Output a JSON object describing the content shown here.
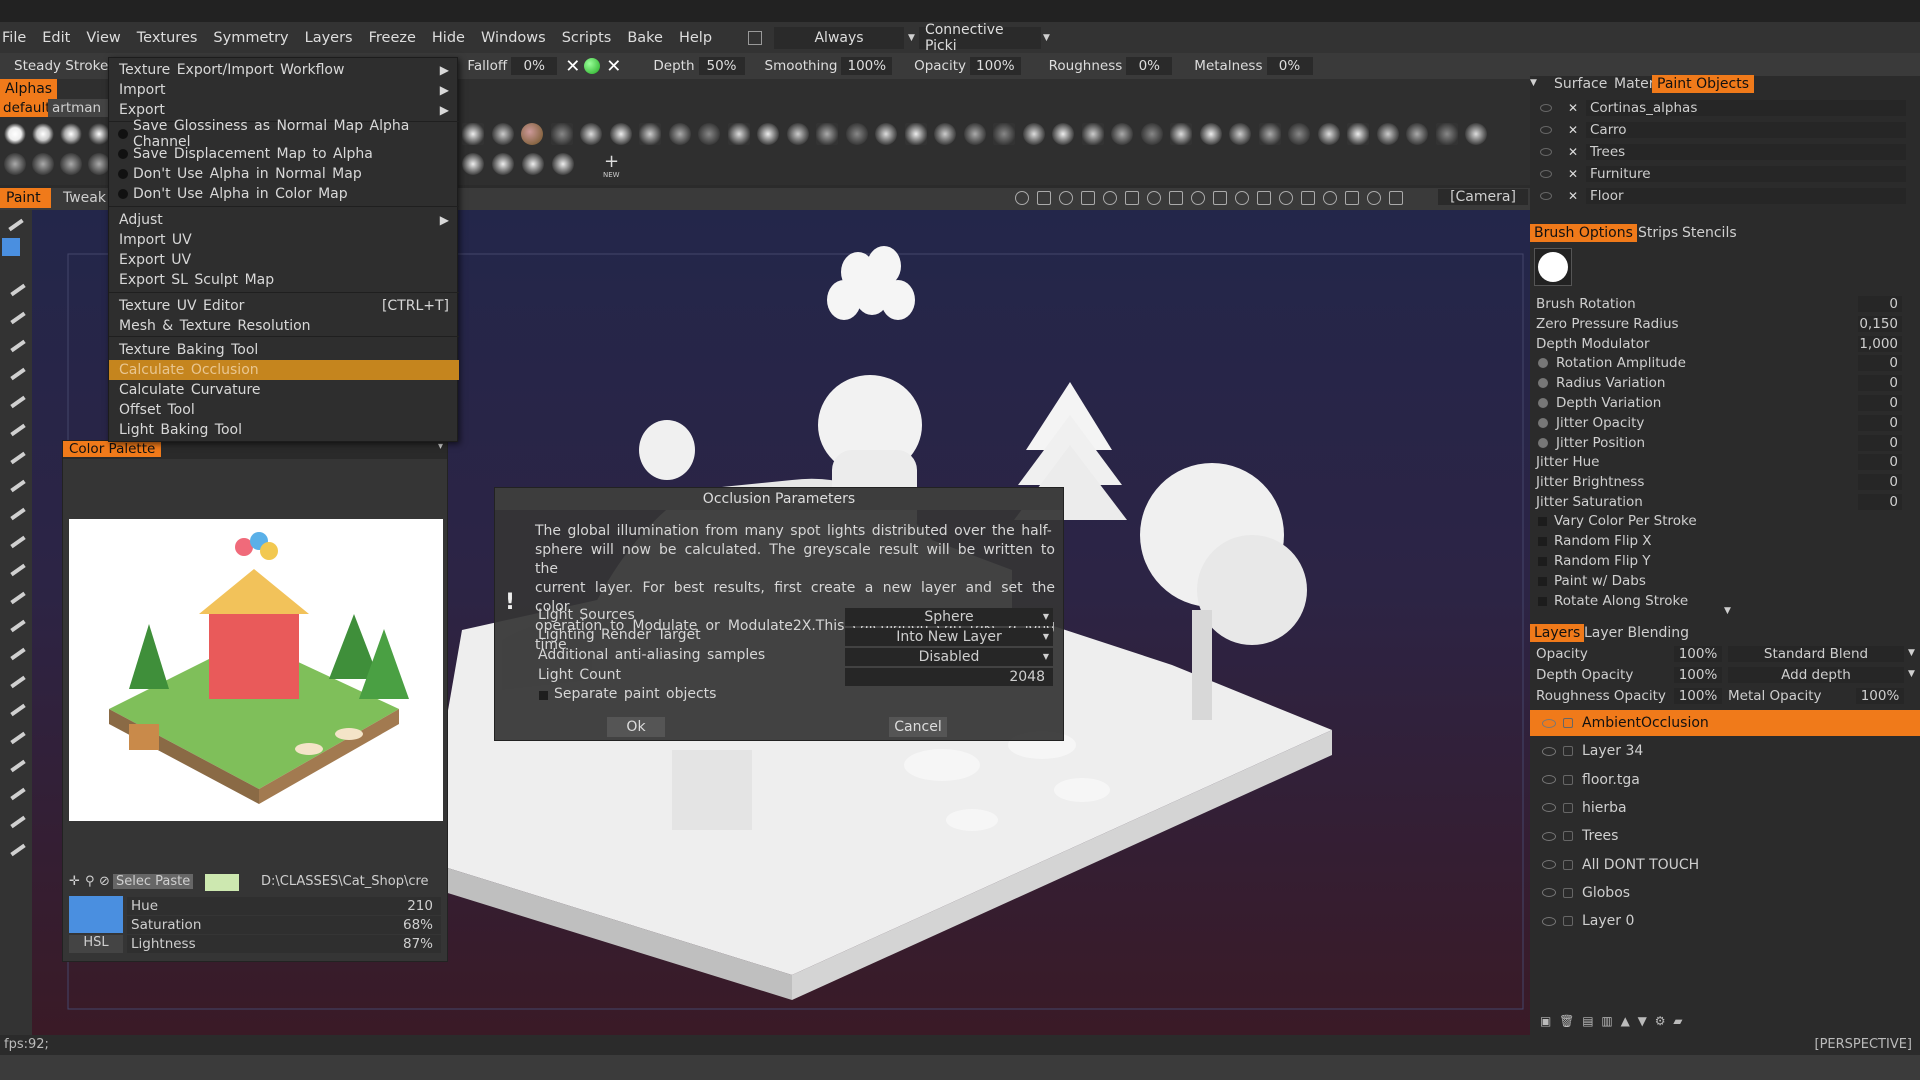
{
  "menubar": {
    "items": [
      "File",
      "Edit",
      "View",
      "Textures",
      "Symmetry",
      "Layers",
      "Freeze",
      "Hide",
      "Windows",
      "Scripts",
      "Bake",
      "Help"
    ],
    "always": "Always",
    "connective": "Connective Picki"
  },
  "toolbar": {
    "steady": "Steady",
    "stroke": "Stroke",
    "falloff": "Falloff",
    "falloff_val": "0%",
    "depth": "Depth",
    "depth_val": "50%",
    "smoothing": "Smoothing",
    "smoothing_val": "100%",
    "opacity": "Opacity",
    "opacity_val": "100%",
    "roughness": "Roughness",
    "roughness_val": "0%",
    "metalness": "Metalness",
    "metalness_val": "0%"
  },
  "alphas": {
    "tab": "Alphas",
    "preset_default": "default",
    "preset_artman": "artman",
    "new_label": "NEW"
  },
  "paint_tabs": {
    "paint": "Paint",
    "tweak": "Tweak",
    "camera": "[Camera]"
  },
  "textures_menu": {
    "items": [
      {
        "label": "Texture Export/Import Workflow",
        "submenu": true
      },
      {
        "label": "Import",
        "submenu": true
      },
      {
        "label": "Export",
        "submenu": true
      },
      {
        "label": "Save Glossiness as Normal Map Alpha Channel",
        "bullet": true
      },
      {
        "label": "Save Displacement Map to Alpha",
        "bullet": true
      },
      {
        "label": "Don't Use Alpha in Normal Map",
        "bullet": true
      },
      {
        "label": "Don't Use Alpha in Color Map",
        "bullet": true
      },
      {
        "label": "Adjust",
        "submenu": true
      },
      {
        "label": "Import UV"
      },
      {
        "label": "Export UV"
      },
      {
        "label": "Export SL Sculpt Map"
      },
      {
        "label": "Texture UV Editor",
        "shortcut": "[CTRL+T]"
      },
      {
        "label": "Mesh & Texture Resolution"
      },
      {
        "label": "Texture Baking Tool"
      },
      {
        "label": "Calculate Occlusion",
        "highlighted": true
      },
      {
        "label": "Calculate Curvature"
      },
      {
        "label": "Offset Tool"
      },
      {
        "label": "Light Baking Tool"
      }
    ]
  },
  "color_palette": {
    "title": "Color Palette",
    "selec_paste": "Selec Paste",
    "path": "D:\\CLASSES\\Cat_Shop\\cre",
    "hue_label": "Hue",
    "hue": "210",
    "sat_label": "Saturation",
    "sat": "68%",
    "light_label": "Lightness",
    "light": "87%",
    "mode": "HSL",
    "swatch_color": "#4a8fe0"
  },
  "dialog": {
    "title": "Occlusion Parameters",
    "text": [
      "The global illumination from many spot lights distributed over the half-",
      "sphere will now be calculated. The greyscale result will be written to the",
      "current layer. For best results, first create a new layer and set the color",
      "operation to Modulate or Modulate2X.This calculation can take a long time"
    ],
    "light_sources_label": "Light Sources",
    "light_sources": "Sphere",
    "render_target_label": "Lighting Render Target",
    "render_target": "Into New Layer",
    "aa_label": "Additional anti-aliasing samples",
    "aa": "Disabled",
    "light_count_label": "Light Count",
    "light_count": "2048",
    "separate_label": "Separate paint objects",
    "ok": "Ok",
    "cancel": "Cancel"
  },
  "right_panel": {
    "tabs": [
      "Surface",
      "Materials",
      "Paint Objects"
    ],
    "objects": [
      "Cortinas_alphas",
      "Carro",
      "Trees",
      "Furniture",
      "Floor"
    ],
    "brush_tabs": [
      "Brush Options",
      "Strips",
      "Stencils"
    ],
    "brush_rows": [
      {
        "label": "Brush Rotation",
        "value": "0"
      },
      {
        "label": "Zero Pressure Radius",
        "value": "0,150"
      },
      {
        "label": "Depth Modulator",
        "value": "1,000"
      },
      {
        "label": "Rotation Amplitude",
        "value": "0"
      },
      {
        "label": "Radius Variation",
        "value": "0"
      },
      {
        "label": "Depth Variation",
        "value": "0"
      },
      {
        "label": "Jitter Opacity",
        "value": "0"
      },
      {
        "label": "Jitter Position",
        "value": "0"
      },
      {
        "label": "Jitter Hue",
        "value": "0"
      },
      {
        "label": "Jitter Brightness",
        "value": "0"
      },
      {
        "label": "Jitter Saturation",
        "value": "0"
      }
    ],
    "brush_checks": [
      "Vary Color Per Stroke",
      "Random Flip X",
      "Random Flip Y",
      "Paint w/ Dabs",
      "Rotate Along Stroke"
    ],
    "layer_tabs": [
      "Layers",
      "Layer Blending"
    ],
    "opacity_label": "Opacity",
    "opacity": "100%",
    "blend": "Standard Blend",
    "depth_opacity_label": "Depth Opacity",
    "depth_opacity": "100%",
    "add_depth": "Add depth",
    "rough_opacity_label": "Roughness Opacity",
    "rough_opacity": "100%",
    "metal_opacity_label": "Metal Opacity",
    "metal_opacity": "100%",
    "layers": [
      "AmbientOcclusion",
      "Layer 34",
      "floor.tga",
      "hierba",
      "Trees",
      "All DONT TOUCH",
      "Globos",
      "Layer 0"
    ]
  },
  "status": {
    "fps": "fps:92;",
    "view": "[PERSPECTIVE]"
  },
  "colors": {
    "accent": "#f07a1a",
    "menu_highlight": "#c5851e"
  }
}
